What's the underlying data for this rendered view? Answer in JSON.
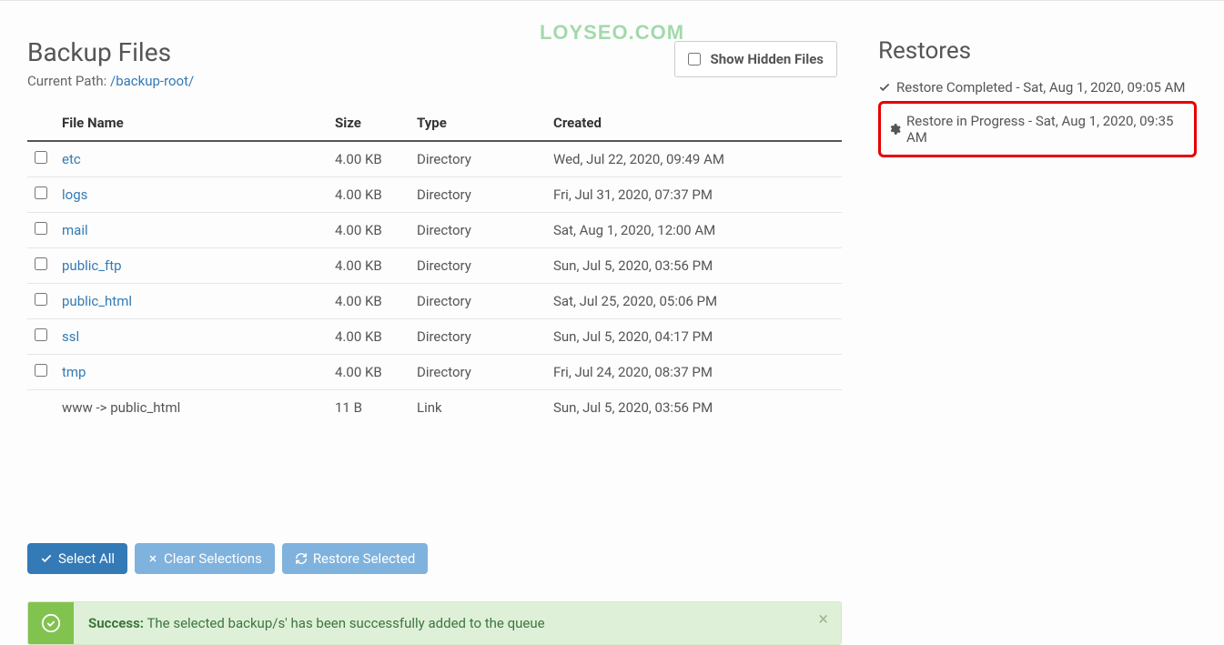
{
  "watermark": "LOYSEO.COM",
  "header": {
    "title": "Backup Files",
    "path_label": "Current Path: ",
    "path_link": "/backup-root/",
    "show_hidden_label": "Show Hidden Files"
  },
  "table": {
    "cols": {
      "name": "File Name",
      "size": "Size",
      "type": "Type",
      "created": "Created"
    },
    "rows": [
      {
        "name": "etc",
        "size": "4.00 KB",
        "type": "Directory",
        "created": "Wed, Jul 22, 2020, 09:49 AM",
        "link": true,
        "checkbox": true
      },
      {
        "name": "logs",
        "size": "4.00 KB",
        "type": "Directory",
        "created": "Fri, Jul 31, 2020, 07:37 PM",
        "link": true,
        "checkbox": true
      },
      {
        "name": "mail",
        "size": "4.00 KB",
        "type": "Directory",
        "created": "Sat, Aug 1, 2020, 12:00 AM",
        "link": true,
        "checkbox": true
      },
      {
        "name": "public_ftp",
        "size": "4.00 KB",
        "type": "Directory",
        "created": "Sun, Jul 5, 2020, 03:56 PM",
        "link": true,
        "checkbox": true
      },
      {
        "name": "public_html",
        "size": "4.00 KB",
        "type": "Directory",
        "created": "Sat, Jul 25, 2020, 05:06 PM",
        "link": true,
        "checkbox": true
      },
      {
        "name": "ssl",
        "size": "4.00 KB",
        "type": "Directory",
        "created": "Sun, Jul 5, 2020, 04:17 PM",
        "link": true,
        "checkbox": true
      },
      {
        "name": "tmp",
        "size": "4.00 KB",
        "type": "Directory",
        "created": "Fri, Jul 24, 2020, 08:37 PM",
        "link": true,
        "checkbox": true
      },
      {
        "name": "www -> public_html",
        "size": "11 B",
        "type": "Link",
        "created": "Sun, Jul 5, 2020, 03:56 PM",
        "link": false,
        "checkbox": false
      }
    ]
  },
  "actions": {
    "select_all": "Select All",
    "clear": "Clear Selections",
    "restore": "Restore Selected"
  },
  "alert": {
    "strong": "Success:",
    "text": " The selected backup/s' has been successfully added to the queue"
  },
  "restores": {
    "title": "Restores",
    "items": [
      {
        "status": "done",
        "text": "Restore Completed - Sat, Aug 1, 2020, 09:05 AM"
      },
      {
        "status": "progress",
        "text": "Restore in Progress - Sat, Aug 1, 2020, 09:35 AM"
      }
    ]
  }
}
